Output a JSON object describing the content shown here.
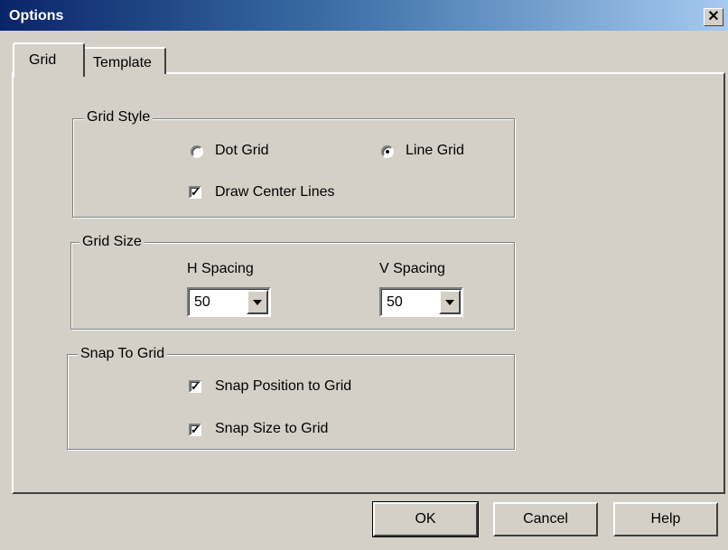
{
  "window": {
    "title": "Options",
    "close_icon": "close-icon"
  },
  "tabs": [
    {
      "label": "Grid",
      "selected": true
    },
    {
      "label": "Template",
      "selected": false
    }
  ],
  "grid_style": {
    "label": "Grid Style",
    "dot_grid_label": "Dot Grid",
    "dot_grid_selected": false,
    "line_grid_label": "Line Grid",
    "line_grid_selected": true,
    "draw_center_lines_label": "Draw Center Lines",
    "draw_center_lines_checked": true
  },
  "grid_size": {
    "label": "Grid Size",
    "h_spacing_label": "H Spacing",
    "h_spacing_value": "50",
    "v_spacing_label": "V Spacing",
    "v_spacing_value": "50"
  },
  "snap_to_grid": {
    "label": "Snap To Grid",
    "snap_position_label": "Snap Position to Grid",
    "snap_position_checked": true,
    "snap_size_label": "Snap Size to Grid",
    "snap_size_checked": true
  },
  "buttons": {
    "ok": "OK",
    "cancel": "Cancel",
    "help": "Help"
  },
  "colors": {
    "face": "#d4d0c8",
    "title_start": "#0a246a",
    "title_end": "#a6caf0"
  }
}
